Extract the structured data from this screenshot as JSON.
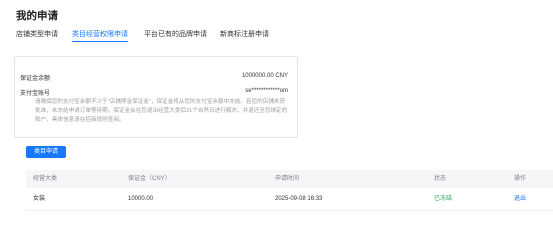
{
  "page_title": "我的申请",
  "tabs": [
    {
      "label": "店铺类型申请"
    },
    {
      "label": "类目经营权限申请"
    },
    {
      "label": "平台已有的品牌申请"
    },
    {
      "label": "新商标注册申请"
    }
  ],
  "info": {
    "deposit_label": "保证金余额",
    "deposit_value": "1000000.00 CNY",
    "alipay_label": "支付宝账号",
    "alipay_value": "se************om",
    "notice": "请确保您的支付宝余额不少于\"店铺押金保证金\"，保证金将从您的支付宝余额中冻结。若您的店铺未获批准，未冻结申请订单等待期，保证金会在您退出经营大类后31个自然日进行解冻，并退还至您绑定的账户，具体信息请在招商规则查阅。"
  },
  "apply_button": "类目申请",
  "table": {
    "headers": [
      "经营大类",
      "保证金（CNY）",
      "申请时间",
      "状态",
      "操作"
    ],
    "rows": [
      {
        "category": "女装",
        "deposit": "10000.00",
        "time": "2025-09-08 16:33",
        "status": "已冻结",
        "action": "退出"
      }
    ]
  },
  "colors": {
    "accent": "#1677ff",
    "status_ok": "#27a15a"
  }
}
